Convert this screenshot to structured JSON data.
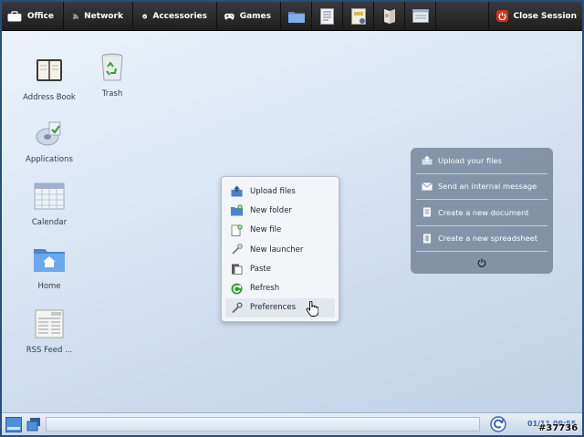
{
  "topbar": {
    "menus": [
      {
        "label": "Office",
        "icon": "briefcase-icon"
      },
      {
        "label": "Network",
        "icon": "wifi-icon"
      },
      {
        "label": "Accessories",
        "icon": "checkmark-icon"
      },
      {
        "label": "Games",
        "icon": "gamepad-icon"
      }
    ],
    "launchers": [
      "folder-icon",
      "text-editor-icon",
      "calendar-app-icon",
      "user-icon",
      "window-icon"
    ],
    "close_session": "Close Session"
  },
  "desktop": {
    "icons": [
      {
        "label": "Address Book",
        "icon": "address-book-icon"
      },
      {
        "label": "Trash",
        "icon": "trash-icon"
      },
      {
        "label": "Applications",
        "icon": "applications-icon"
      },
      {
        "label": "Calendar",
        "icon": "calendar-icon"
      },
      {
        "label": "Home",
        "icon": "home-folder-icon"
      },
      {
        "label": "RSS Feed ...",
        "icon": "rss-news-icon"
      }
    ]
  },
  "context_menu": {
    "items": [
      {
        "label": "Upload files",
        "icon": "upload-icon"
      },
      {
        "label": "New folder",
        "icon": "new-folder-icon"
      },
      {
        "label": "New file",
        "icon": "new-file-icon"
      },
      {
        "label": "New launcher",
        "icon": "new-launcher-icon"
      },
      {
        "label": "Paste",
        "icon": "paste-icon"
      },
      {
        "label": "Refresh",
        "icon": "refresh-icon"
      },
      {
        "label": "Preferences",
        "icon": "preferences-icon"
      }
    ],
    "highlighted": "Preferences"
  },
  "quick_panel": {
    "items": [
      {
        "label": "Upload your files",
        "icon": "upload-icon"
      },
      {
        "label": "Send an internal message",
        "icon": "message-icon"
      },
      {
        "label": "Create a new document",
        "icon": "document-icon"
      },
      {
        "label": "Create a new spreadsheet",
        "icon": "spreadsheet-icon"
      }
    ],
    "power_icon": "power-icon"
  },
  "bottombar": {
    "clock": "01/11  09:55"
  },
  "watermark": "#37736",
  "colors": {
    "accent": "#3a66a8",
    "close_red": "#c8351f",
    "topbar": "#2a2a2a"
  }
}
